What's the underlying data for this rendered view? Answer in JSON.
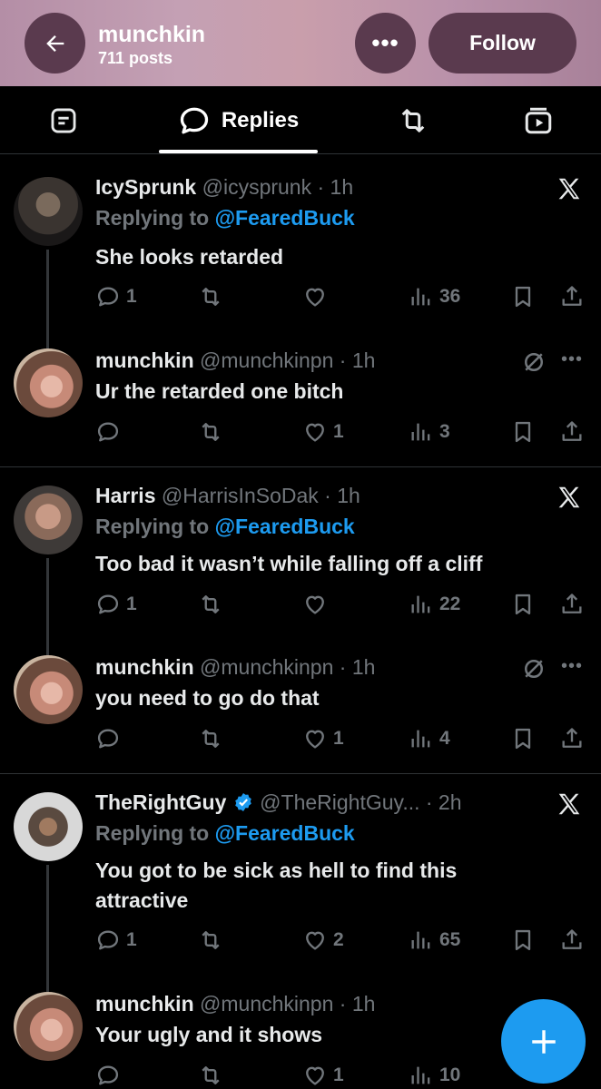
{
  "header": {
    "title": "munchkin",
    "subtitle": "711 posts",
    "follow_label": "Follow",
    "more_label": "•••",
    "bg_color": "#c4a0b4"
  },
  "tabs": {
    "active_label": "Replies",
    "icons": [
      "list-icon",
      "reply-bubble-icon",
      "retweet-icon",
      "media-icon"
    ]
  },
  "posts": [
    {
      "name": "IcySprunk",
      "handle": "@icysprunk · 1h",
      "replying_prefix": "Replying to ",
      "replying_to": "@FearedBuck",
      "text": "She looks retarded",
      "replies": "1",
      "likes": "",
      "views": "36"
    },
    {
      "name": "munchkin",
      "handle": "@munchkinpn · 1h",
      "text": "Ur the retarded one bitch",
      "replies": "",
      "likes": "1",
      "views": "3"
    },
    {
      "name": "Harris",
      "handle": "@HarrisInSoDak · 1h",
      "replying_prefix": "Replying to ",
      "replying_to": "@FearedBuck",
      "text": "Too bad it wasn’t while falling off a cliff",
      "replies": "1",
      "likes": "",
      "views": "22"
    },
    {
      "name": "munchkin",
      "handle": "@munchkinpn · 1h",
      "text": "you need to go do that",
      "replies": "",
      "likes": "1",
      "views": "4"
    },
    {
      "name": "TheRightGuy",
      "handle": "@TheRightGuy... · 2h",
      "replying_prefix": "Replying to ",
      "replying_to": "@FearedBuck",
      "text": "You got to be sick as hell to find this attractive",
      "replies": "1",
      "likes": "2",
      "views": "65"
    },
    {
      "name": "munchkin",
      "handle": "@munchkinpn · 1h",
      "text": "Your ugly and it shows",
      "replies": "",
      "likes": "1",
      "views": "10"
    }
  ],
  "more_dots": "•••",
  "fab_label": "+",
  "colors": {
    "accent": "#1d9bf0",
    "muted": "#71767b",
    "divider": "#2f3336"
  }
}
